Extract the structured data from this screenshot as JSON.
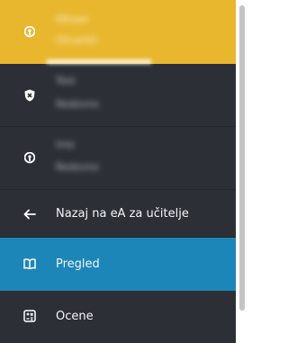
{
  "sidebar": {
    "accounts": [
      {
        "line1": "Mihael",
        "line2": "Ohrankil",
        "icon": "lock-icon"
      },
      {
        "line1": "Test",
        "line2": "Redovno",
        "icon": "shield-icon"
      },
      {
        "line1": "Ime",
        "line2": "Redovno",
        "icon": "lock-icon"
      }
    ],
    "nav": [
      {
        "label": "Nazaj na eA za učitelje",
        "icon": "arrow-left-icon"
      },
      {
        "label": "Pregled",
        "icon": "book-open-icon"
      },
      {
        "label": "Ocene",
        "icon": "grades-icon"
      }
    ]
  },
  "colors": {
    "sidebar_bg": "#2c3036",
    "active_yellow": "#e8b72e",
    "active_blue": "#1d86b8",
    "text": "#f4f4f4"
  }
}
